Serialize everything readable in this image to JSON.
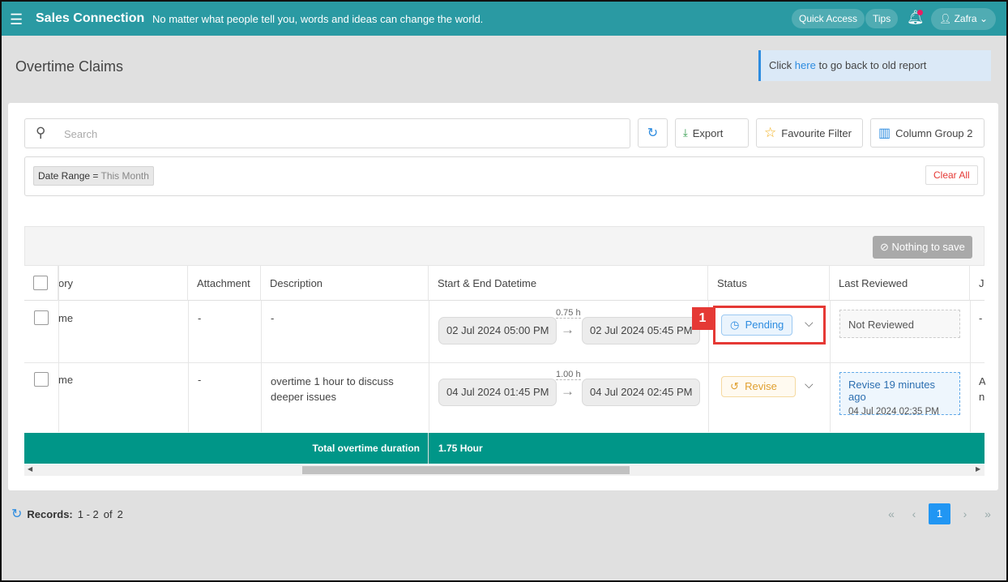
{
  "header": {
    "app_title": "Sales Connection",
    "tagline": "No matter what people tell you, words and ideas can change the world.",
    "quick_access": "Quick Access",
    "tips": "Tips",
    "user": "Zafra"
  },
  "page": {
    "title": "Overtime Claims",
    "old_report_prefix": "Click",
    "old_report_link": "here",
    "old_report_suffix": "to go back to old report"
  },
  "toolbar": {
    "search_placeholder": "Search",
    "export": "Export",
    "favourite_filter": "Favourite Filter",
    "column_group": "Column Group 2"
  },
  "filters": {
    "chip_label": "Date Range =",
    "chip_value": "This Month",
    "clear_all": "Clear All"
  },
  "table": {
    "nothing_to_save": "Nothing to save",
    "columns": [
      "ory",
      "Attachment",
      "Description",
      "Start & End Datetime",
      "Status",
      "Last Reviewed",
      "J"
    ],
    "rows": [
      {
        "category": "me",
        "attachment": "-",
        "description": "-",
        "start": "02 Jul 2024 05:00 PM",
        "end": "02 Jul 2024 05:45 PM",
        "duration": "0.75 h",
        "status": "Pending",
        "last_reviewed": "Not Reviewed",
        "last_reviewed_date": "",
        "extra": "-"
      },
      {
        "category": "me",
        "attachment": "-",
        "description": "overtime 1 hour to discuss deeper issues",
        "start": "04 Jul 2024 01:45 PM",
        "end": "04 Jul 2024 02:45 PM",
        "duration": "1.00 h",
        "status": "Revise",
        "last_reviewed": "Revise 19 minutes ago",
        "last_reviewed_date": "04 Jul 2024 02:35 PM",
        "extra": "A\nn"
      }
    ],
    "total_label": "Total overtime duration",
    "total_value": "1.75 Hour"
  },
  "annotation": {
    "marker": "1"
  },
  "pagination": {
    "records_label": "Records:",
    "range": "1 - 2",
    "of": "of",
    "total": "2",
    "current_page": "1"
  },
  "colors": {
    "header": "#2a9aa3",
    "footer": "#009688",
    "accent": "#2d8ce0",
    "pending": "#2d8ce0",
    "revise": "#e0a030",
    "highlight": "#e53935"
  }
}
